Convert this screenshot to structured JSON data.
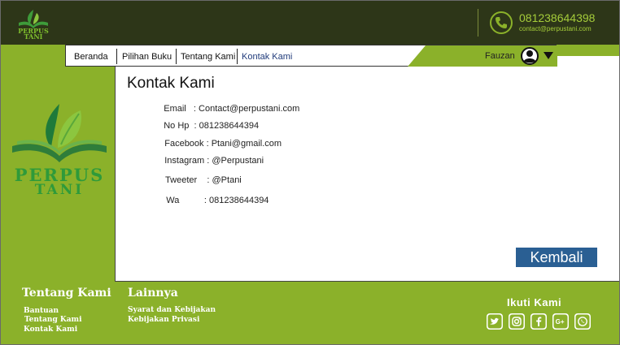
{
  "brand": {
    "logo_line1": "PERPUS",
    "logo_line2": "TANI"
  },
  "header": {
    "phone": "081238644398",
    "email": "contact@perpustani.com"
  },
  "nav": {
    "items": [
      {
        "label": "Beranda"
      },
      {
        "label": "Pilihan Buku"
      },
      {
        "label": "Tentang Kami"
      },
      {
        "label": "Kontak Kami"
      }
    ],
    "active": "Kontak Kami",
    "user_name": "Fauzan"
  },
  "page": {
    "title": "Kontak Kami",
    "contacts": [
      {
        "label": "Email",
        "sep": "   : ",
        "value": "Contact@perpustani.com"
      },
      {
        "label": "No Hp",
        "sep": "  : ",
        "value": "081238644394"
      },
      {
        "label": "Facebook",
        "sep": " : ",
        "value": "Ptani@gmail.com"
      },
      {
        "label": "Instagram",
        "sep": " : ",
        "value": "@Perpustani"
      },
      {
        "label": "Tweeter",
        "sep": "    : ",
        "value": "@Ptani"
      },
      {
        "label": "Wa",
        "sep": "          : ",
        "value": "081238644394"
      }
    ],
    "back_label": "Kembali"
  },
  "footer": {
    "about_title": "Tentang Kami",
    "about_links": [
      "Bantuan",
      "Tentang Kami",
      "Kontak Kami"
    ],
    "more_title": "Lainnya",
    "more_links": [
      "Syarat dan Kebijakan",
      "Kebijakan Privasi"
    ],
    "follow_title": "Ikuti Kami",
    "social_icons": [
      "twitter-icon",
      "instagram-icon",
      "facebook-icon",
      "google-plus-icon",
      "whatsapp-icon"
    ]
  },
  "colors": {
    "dark": "#2d3618",
    "accent": "#8bb12a",
    "button": "#2a5f93",
    "logo_green": "#2f9a3a"
  }
}
